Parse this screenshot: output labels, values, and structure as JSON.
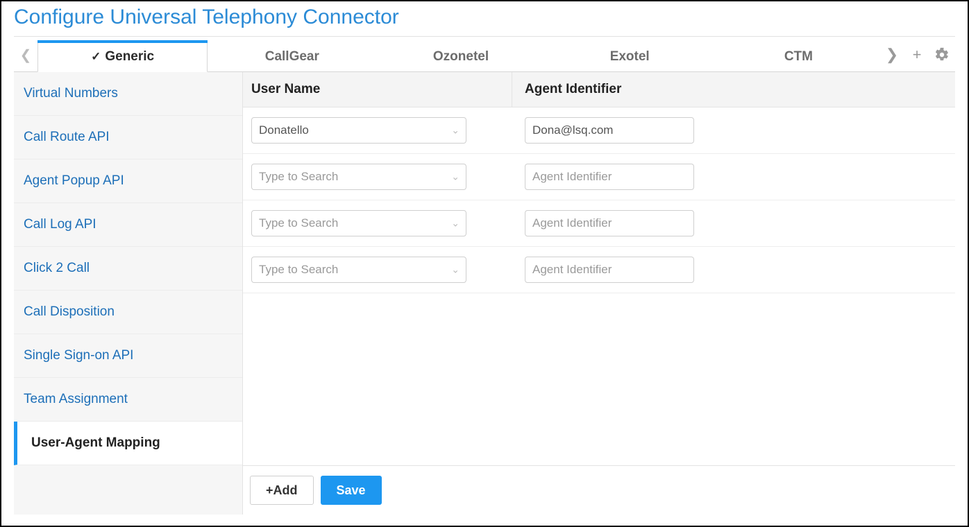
{
  "header": {
    "title": "Configure Universal Telephony Connector"
  },
  "tabs": {
    "items": [
      {
        "label": "Generic",
        "active": true,
        "checked": true
      },
      {
        "label": "CallGear",
        "active": false
      },
      {
        "label": "Ozonetel",
        "active": false
      },
      {
        "label": "Exotel",
        "active": false
      },
      {
        "label": "CTM",
        "active": false
      }
    ]
  },
  "sidebar": {
    "items": [
      {
        "label": "Virtual Numbers",
        "active": false
      },
      {
        "label": "Call Route API",
        "active": false
      },
      {
        "label": "Agent Popup API",
        "active": false
      },
      {
        "label": "Call Log API",
        "active": false
      },
      {
        "label": "Click 2 Call",
        "active": false
      },
      {
        "label": "Call Disposition",
        "active": false
      },
      {
        "label": "Single Sign-on API",
        "active": false
      },
      {
        "label": "Team Assignment",
        "active": false
      },
      {
        "label": "User-Agent Mapping",
        "active": true
      }
    ]
  },
  "table": {
    "columns": {
      "username": "User Name",
      "agentid": "Agent Identifier"
    },
    "search_placeholder": "Type to Search",
    "agent_placeholder": "Agent Identifier",
    "rows": [
      {
        "user": "Donatello",
        "agent": "Dona@lsq.com"
      },
      {
        "user": "",
        "agent": ""
      },
      {
        "user": "",
        "agent": ""
      },
      {
        "user": "",
        "agent": ""
      }
    ]
  },
  "footer": {
    "add_label": "+Add",
    "save_label": "Save"
  }
}
